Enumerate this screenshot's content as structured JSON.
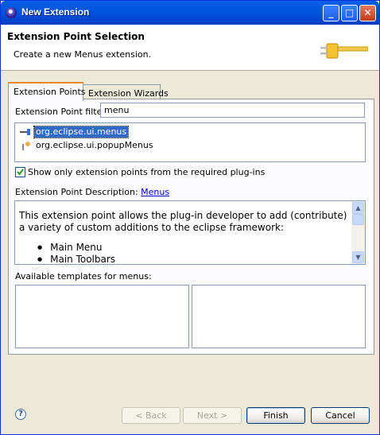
{
  "window": {
    "title": "New Extension"
  },
  "header": {
    "title": "Extension Point Selection",
    "subtitle": "Create a new Menus extension."
  },
  "tabs": [
    {
      "label": "Extension Points",
      "active": true
    },
    {
      "label": "Extension Wizards",
      "active": false
    }
  ],
  "filter": {
    "label": "Extension Point filter:",
    "value": "menu"
  },
  "extension_points": [
    {
      "label": "org.eclipse.ui.menus",
      "selected": true,
      "icon": "plug-icon"
    },
    {
      "label": "org.eclipse.ui.popupMenus",
      "selected": false,
      "icon": "plug-icon"
    }
  ],
  "show_required": {
    "label": "Show only extension points from the required plug-ins",
    "checked": true
  },
  "description": {
    "label": "Extension Point Description:",
    "link": "Menus",
    "text": "This extension point allows the plug-in developer to add (contribute) a variety of custom additions to the eclipse framework:",
    "bullets": [
      "Main Menu",
      "Main Toolbars"
    ]
  },
  "templates": {
    "label": "Available templates for menus:"
  },
  "buttons": {
    "back": "< Back",
    "next": "Next >",
    "finish": "Finish",
    "cancel": "Cancel"
  }
}
